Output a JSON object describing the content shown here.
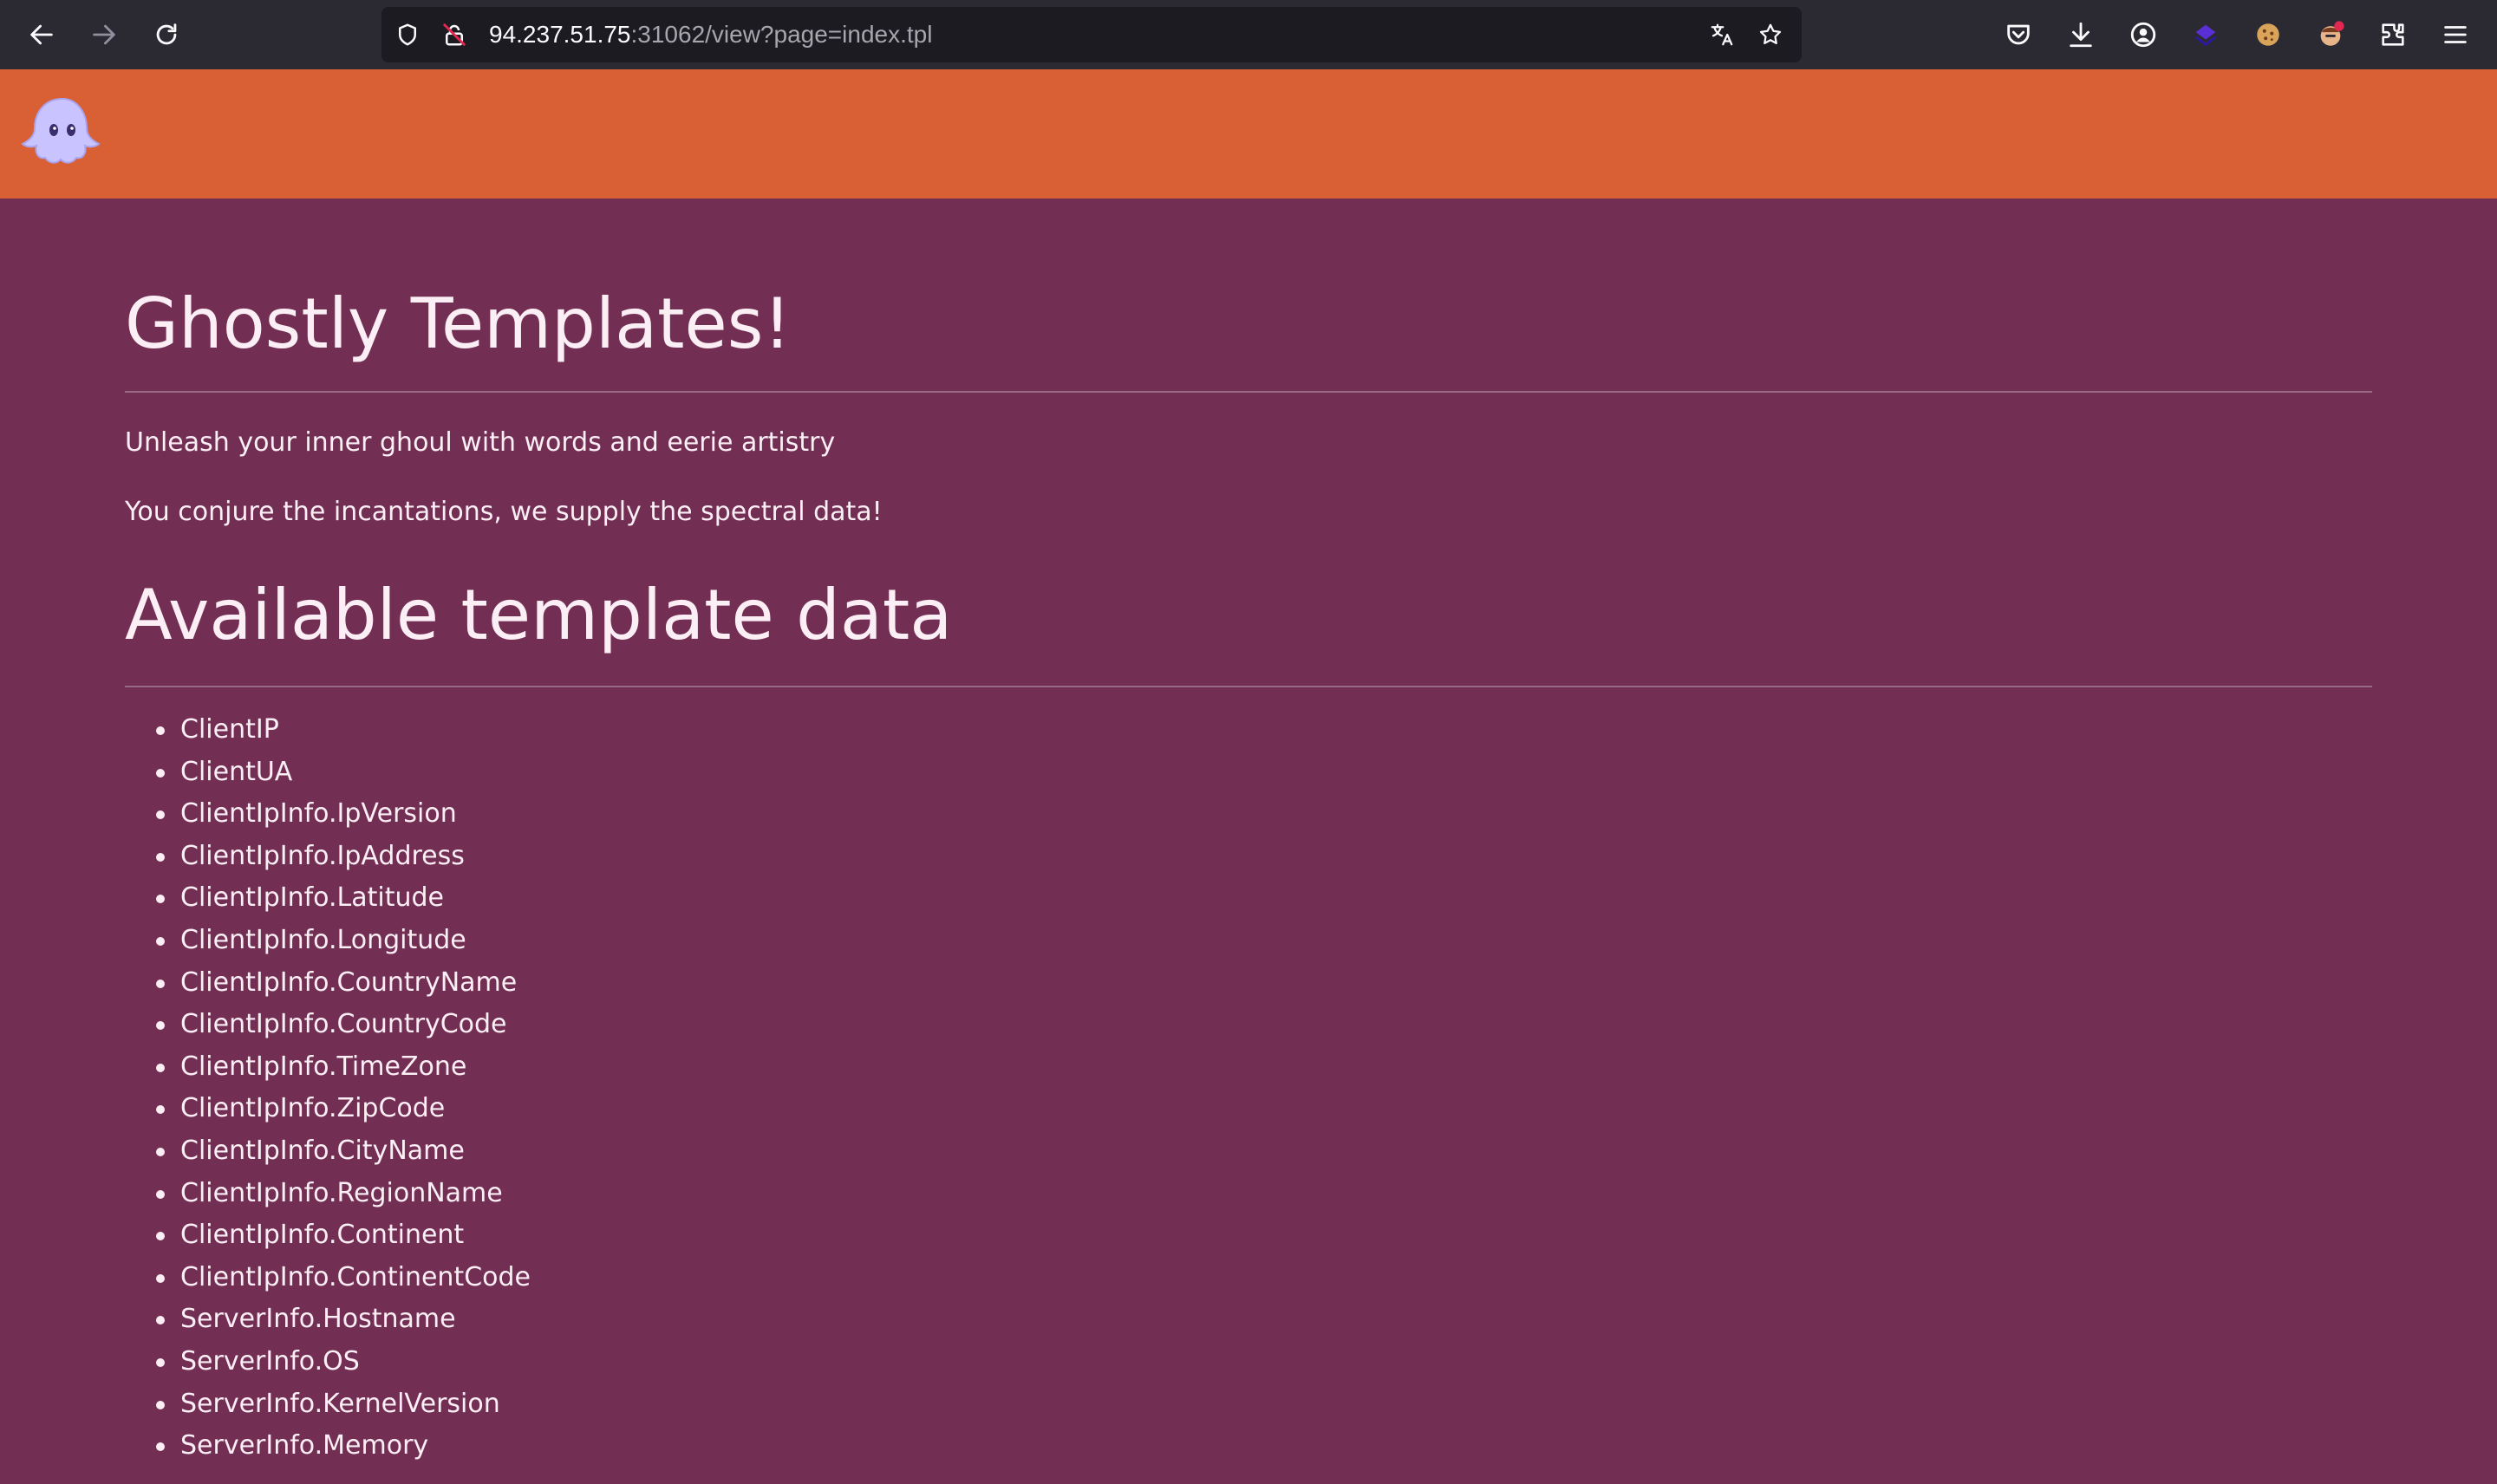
{
  "browser": {
    "url_host": "94.237.51.75",
    "url_rest": ":31062/view?page=index.tpl",
    "icons": [
      "back-icon",
      "forward-icon",
      "reload-icon",
      "shield-icon",
      "insecure-lock-icon",
      "translate-icon",
      "bookmark-star-icon",
      "pocket-icon",
      "download-icon",
      "account-icon",
      "extension-icon",
      "cookie-icon",
      "avatar-extension-icon",
      "extensions-puzzle-icon",
      "menu-icon"
    ]
  },
  "header": {
    "logo": "ghost-icon",
    "color": "#d95f35"
  },
  "main": {
    "background": "#722e53",
    "title": "Ghostly Templates!",
    "tagline1": "Unleash your inner ghoul with words and eerie artistry",
    "tagline2": "You conjure the incantations, we supply the spectral data!",
    "section_title": "Available template data",
    "items": [
      "ClientIP",
      "ClientUA",
      "ClientIpInfo.IpVersion",
      "ClientIpInfo.IpAddress",
      "ClientIpInfo.Latitude",
      "ClientIpInfo.Longitude",
      "ClientIpInfo.CountryName",
      "ClientIpInfo.CountryCode",
      "ClientIpInfo.TimeZone",
      "ClientIpInfo.ZipCode",
      "ClientIpInfo.CityName",
      "ClientIpInfo.RegionName",
      "ClientIpInfo.Continent",
      "ClientIpInfo.ContinentCode",
      "ServerInfo.Hostname",
      "ServerInfo.OS",
      "ServerInfo.KernelVersion",
      "ServerInfo.Memory"
    ]
  }
}
